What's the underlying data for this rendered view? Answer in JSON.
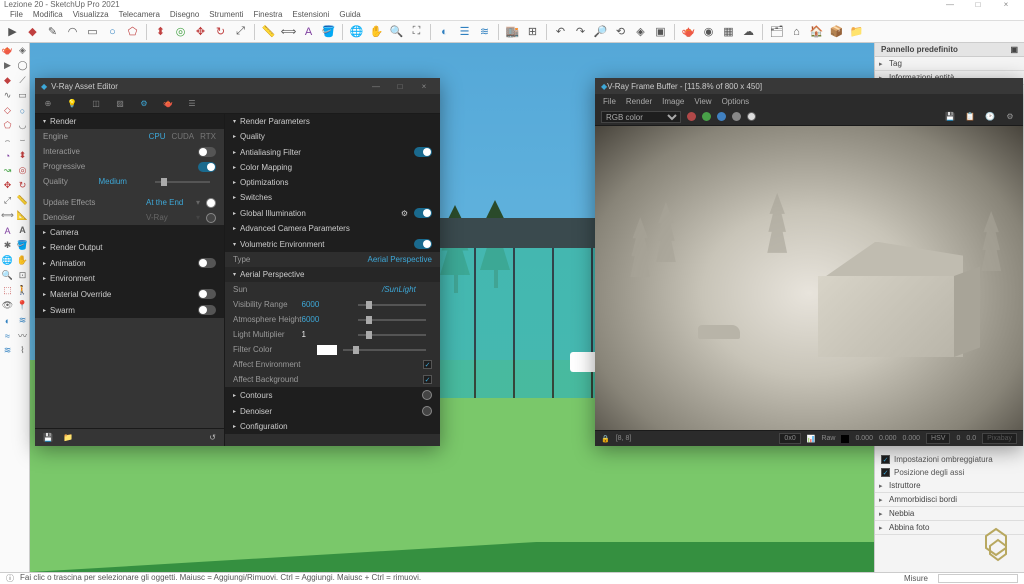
{
  "app": {
    "title": "Lezione 20 - SketchUp Pro 2021"
  },
  "menus": [
    "File",
    "Modifica",
    "Visualizza",
    "Telecamera",
    "Disegno",
    "Strumenti",
    "Finestra",
    "Estensioni",
    "Guida"
  ],
  "rightPanel": {
    "header": "Pannello predefinito",
    "top": [
      "Tag",
      "Informazioni entità"
    ],
    "bottom_checks": [
      "Impostazioni ombreggiatura",
      "Posizione degli assi"
    ],
    "bottom": [
      "Istruttore",
      "Ammorbidisci bordi",
      "Nebbia",
      "Abbina foto"
    ]
  },
  "status": {
    "hint": "Fai clic o trascina per selezionare gli oggetti. Maiusc = Aggiungi/Rimuovi. Ctrl = Aggiungi. Maiusc + Ctrl = rimuovi.",
    "measureLabel": "Misure"
  },
  "vray": {
    "title": "V-Ray Asset Editor",
    "left": {
      "render": {
        "title": "Render",
        "engine": {
          "label": "Engine",
          "opts": [
            "CPU",
            "CUDA",
            "RTX"
          ]
        },
        "interactive": "Interactive",
        "progressive": "Progressive",
        "quality": {
          "label": "Quality",
          "value": "Medium"
        },
        "updateEffects": {
          "label": "Update Effects",
          "value": "At the End"
        },
        "denoiser": {
          "label": "Denoiser",
          "value": "V-Ray"
        }
      },
      "sections": [
        "Camera",
        "Render Output",
        "Animation",
        "Environment",
        "Material Override",
        "Swarm"
      ]
    },
    "right": {
      "header": "Render Parameters",
      "sections": [
        {
          "name": "Quality",
          "toggle": null
        },
        {
          "name": "Antialiasing Filter",
          "toggle": true
        },
        {
          "name": "Color Mapping",
          "toggle": null
        },
        {
          "name": "Optimizations",
          "toggle": null
        },
        {
          "name": "Switches",
          "toggle": null
        },
        {
          "name": "Global Illumination",
          "toggle": true,
          "extra": true
        },
        {
          "name": "Advanced Camera Parameters",
          "toggle": null
        },
        {
          "name": "Volumetric Environment",
          "toggle": true
        }
      ],
      "volType": {
        "label": "Type",
        "value": "Aerial Perspective"
      },
      "aerial": {
        "title": "Aerial Perspective",
        "sun": {
          "label": "Sun",
          "value": "/SunLight"
        },
        "visRange": {
          "label": "Visibility Range",
          "value": "6000"
        },
        "atmHeight": {
          "label": "Atmosphere Height",
          "value": "6000"
        },
        "lightMult": {
          "label": "Light Multiplier",
          "value": "1"
        },
        "filterColor": "Filter Color",
        "affectEnv": "Affect Environment",
        "affectBg": "Affect Background"
      },
      "footerSections": [
        "Contours",
        "Denoiser",
        "Configuration"
      ]
    }
  },
  "vfb": {
    "title": "V-Ray Frame Buffer - [115.8% of 800 x 450]",
    "menus": [
      "File",
      "Render",
      "Image",
      "View",
      "Options"
    ],
    "channel": "RGB color",
    "dots": [
      "#b04848",
      "#48a048",
      "#4080c0",
      "#888888",
      "#cccccc"
    ],
    "status": {
      "coords": "[8, 8]",
      "region": "0x0",
      "raw": "Raw",
      "vals": [
        "0.000",
        "0.000",
        "0.000"
      ],
      "mode": "HSV",
      "extra": [
        "0",
        "0.0"
      ],
      "pixabtn": "Pixabay"
    }
  }
}
